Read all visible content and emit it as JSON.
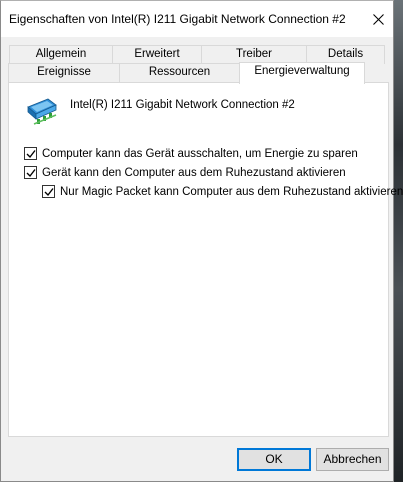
{
  "window": {
    "title": "Eigenschaften von Intel(R) I211 Gigabit Network Connection #2"
  },
  "tabs_row1": [
    "Allgemein",
    "Erweitert",
    "Treiber",
    "Details"
  ],
  "tabs_row2": [
    "Ereignisse",
    "Ressourcen",
    "Energieverwaltung"
  ],
  "active_tab": "Energieverwaltung",
  "device": {
    "name": "Intel(R) I211 Gigabit Network Connection #2",
    "icon": "network-adapter-icon"
  },
  "options": [
    {
      "label": "Computer kann das Gerät ausschalten, um Energie zu sparen",
      "checked": true
    },
    {
      "label": "Gerät kann den Computer aus dem Ruhezustand aktivieren",
      "checked": true
    },
    {
      "label": "Nur Magic Packet kann Computer aus dem Ruhezustand aktivieren",
      "checked": true
    }
  ],
  "buttons": {
    "ok": "OK",
    "cancel": "Abbrechen"
  },
  "colors": {
    "accent": "#0078d7",
    "window_bg": "#f0f0f0",
    "panel_bg": "#ffffff"
  }
}
